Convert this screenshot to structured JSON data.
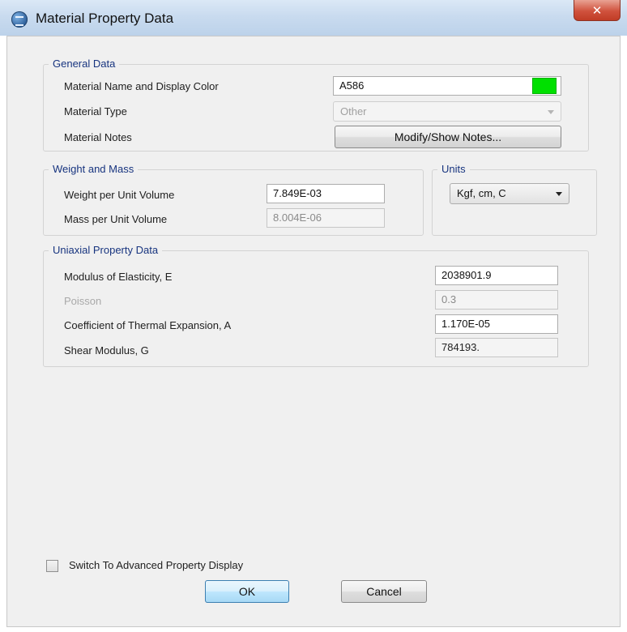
{
  "window": {
    "title": "Material Property Data",
    "close_glyph": "✕"
  },
  "general": {
    "title": "General Data",
    "name_label": "Material Name and Display Color",
    "name_value": "A586",
    "display_color": "#00e000",
    "type_label": "Material Type",
    "type_value": "Other",
    "notes_label": "Material Notes",
    "notes_button": "Modify/Show Notes..."
  },
  "weight_mass": {
    "title": "Weight and Mass",
    "weight_label": "Weight per Unit Volume",
    "weight_value": "7.849E-03",
    "mass_label": "Mass per Unit Volume",
    "mass_value": "8.004E-06"
  },
  "units": {
    "title": "Units",
    "value": "Kgf, cm, C"
  },
  "uniaxial": {
    "title": "Uniaxial Property Data",
    "modulus_label": "Modulus of Elasticity,  E",
    "modulus_value": "2038901.9",
    "poisson_label": "Poisson",
    "poisson_value": "0.3",
    "thermal_label": "Coefficient of Thermal Expansion,  A",
    "thermal_value": "1.170E-05",
    "shear_label": "Shear Modulus,  G",
    "shear_value": "784193."
  },
  "advanced_checkbox_label": "Switch To Advanced Property Display",
  "buttons": {
    "ok": "OK",
    "cancel": "Cancel"
  },
  "icons": {
    "app": "app-icon",
    "close": "close-icon",
    "dropdown": "chevron-down-icon"
  }
}
